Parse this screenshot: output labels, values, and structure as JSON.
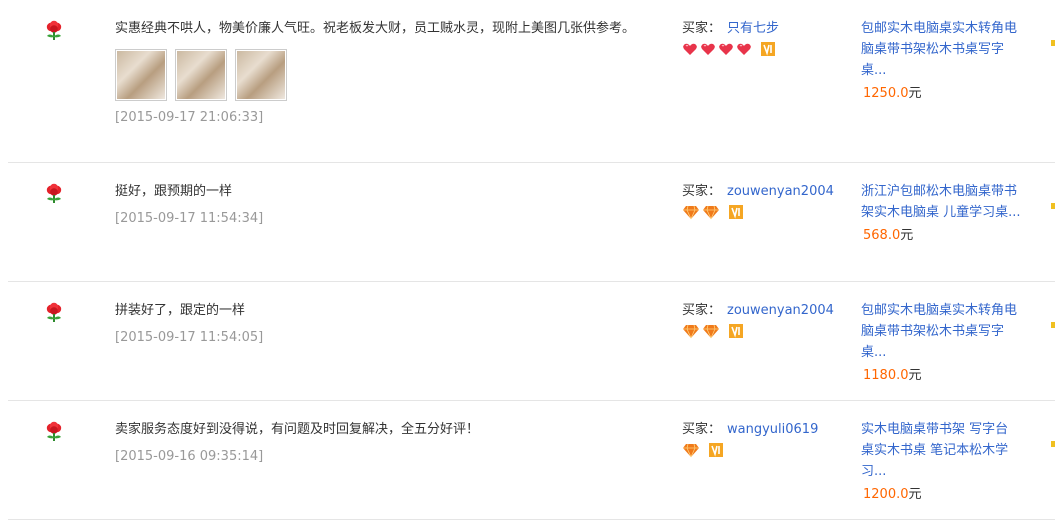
{
  "reviews": [
    {
      "comment": "实惠经典不哄人，物美价廉人气旺。祝老板发大财，员工贼水灵，现附上美图几张供参考。",
      "date": "[2015-09-17 21:06:33]",
      "has_photos": true,
      "buyer_label": "买家：",
      "buyer_name": "只有七步",
      "badge_type": "heart",
      "badge_count": 4,
      "item_title": "包邮实木电脑桌实木转角电脑桌带书架松木书桌写字桌...",
      "price": "1250.0",
      "currency": "元"
    },
    {
      "comment": "挺好，跟预期的一样",
      "date": "[2015-09-17 11:54:34]",
      "has_photos": false,
      "buyer_label": "买家：",
      "buyer_name": "zouwenyan2004",
      "badge_type": "diamond",
      "badge_count": 2,
      "item_title": "浙江沪包邮松木电脑桌带书架实木电脑桌 儿童学习桌...",
      "price": "568.0",
      "currency": "元"
    },
    {
      "comment": "拼装好了，跟定的一样",
      "date": "[2015-09-17 11:54:05]",
      "has_photos": false,
      "buyer_label": "买家：",
      "buyer_name": "zouwenyan2004",
      "badge_type": "diamond",
      "badge_count": 2,
      "item_title": "包邮实木电脑桌实木转角电脑桌带书架松木书桌写字桌...",
      "price": "1180.0",
      "currency": "元"
    },
    {
      "comment": "卖家服务态度好到没得说，有问题及时回复解决，全五分好评！",
      "date": "[2015-09-16 09:35:14]",
      "has_photos": false,
      "buyer_label": "买家：",
      "buyer_name": "wangyuli0619",
      "badge_type": "diamond",
      "badge_count": 1,
      "item_title": "实木电脑桌带书架 写字台桌实木书桌 笔记本松木学习...",
      "price": "1200.0",
      "currency": "元"
    }
  ],
  "icons": {
    "rating": "red-flower-icon",
    "heart": "heart-badge-icon",
    "diamond": "diamond-badge-icon",
    "vip": "vip-icon"
  },
  "colors": {
    "link": "#3366cc",
    "price": "#ff6600",
    "date": "#999999",
    "divider": "#e5e5e5"
  }
}
